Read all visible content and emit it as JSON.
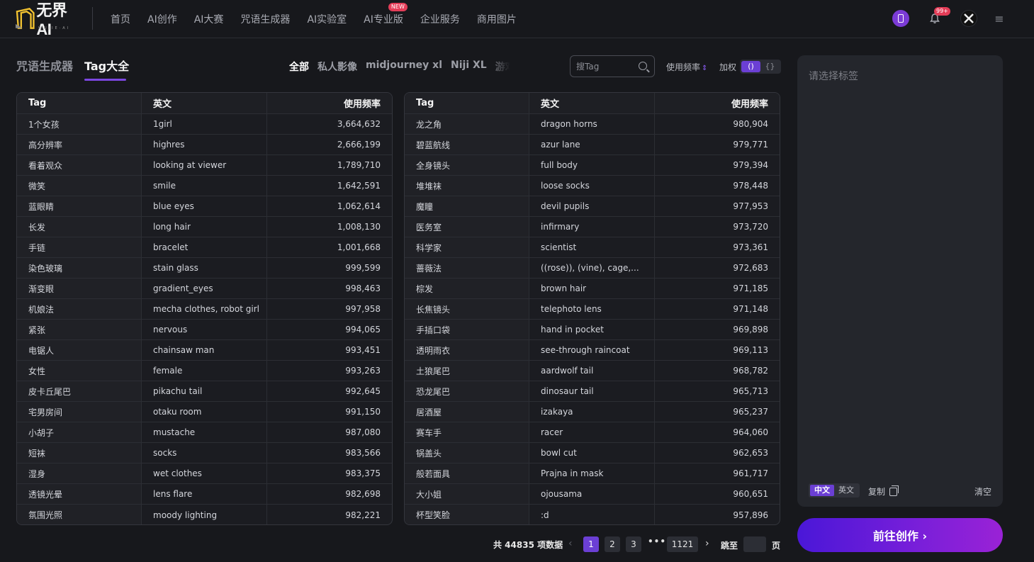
{
  "header": {
    "logo_text": "无界AI",
    "logo_sub": "WUJIE·AI",
    "nav": [
      "首页",
      "AI创作",
      "AI大赛",
      "咒语生成器",
      "AI实验室",
      "AI专业版",
      "企业服务",
      "商用图片"
    ],
    "nav_badge": "NEW",
    "bell_badge": "99+"
  },
  "tabs": {
    "generator": "咒语生成器",
    "tag_all": "Tag大全"
  },
  "categories": [
    "全部",
    "私人影像",
    "midjourney xl",
    "Niji XL",
    "游戏设计"
  ],
  "search": {
    "placeholder": "搜Tag"
  },
  "sort": {
    "label": "使用频率",
    "icon": "sort-icon"
  },
  "weight": {
    "label": "加权",
    "opt1": "()",
    "opt2": "{}"
  },
  "columns": {
    "tag": "Tag",
    "english": "英文",
    "freq": "使用频率"
  },
  "table_left": [
    [
      "1个女孩",
      "1girl",
      "3,664,632"
    ],
    [
      "高分辨率",
      "highres",
      "2,666,199"
    ],
    [
      "看着观众",
      "looking at viewer",
      "1,789,710"
    ],
    [
      "微笑",
      "smile",
      "1,642,591"
    ],
    [
      "蓝眼睛",
      "blue eyes",
      "1,062,614"
    ],
    [
      "长发",
      "long hair",
      "1,008,130"
    ],
    [
      "手链",
      "bracelet",
      "1,001,668"
    ],
    [
      "染色玻璃",
      "stain glass",
      "999,599"
    ],
    [
      "渐变眼",
      "gradient_eyes",
      "998,463"
    ],
    [
      "机娘法",
      "mecha clothes, robot girl",
      "997,958"
    ],
    [
      "紧张",
      "nervous",
      "994,065"
    ],
    [
      "电锯人",
      "chainsaw man",
      "993,451"
    ],
    [
      "女性",
      "female",
      "993,263"
    ],
    [
      "皮卡丘尾巴",
      "pikachu tail",
      "992,645"
    ],
    [
      "宅男房间",
      "otaku room",
      "991,150"
    ],
    [
      "小胡子",
      "mustache",
      "987,080"
    ],
    [
      "短袜",
      "socks",
      "983,566"
    ],
    [
      "湿身",
      "wet clothes",
      "983,375"
    ],
    [
      "透镜光晕",
      "lens flare",
      "982,698"
    ],
    [
      "氛围光照",
      "moody lighting",
      "982,221"
    ]
  ],
  "table_right": [
    [
      "龙之角",
      "dragon horns",
      "980,904"
    ],
    [
      "碧蓝航线",
      "azur lane",
      "979,771"
    ],
    [
      "全身镜头",
      "full body",
      "979,394"
    ],
    [
      "堆堆袜",
      "loose socks",
      "978,448"
    ],
    [
      "魔瞳",
      "devil pupils",
      "977,953"
    ],
    [
      "医务室",
      "infirmary",
      "973,720"
    ],
    [
      "科学家",
      "scientist",
      "973,361"
    ],
    [
      "蔷薇法",
      "((rose)), (vine), cage,...",
      "972,683"
    ],
    [
      "棕发",
      "brown hair",
      "971,185"
    ],
    [
      "长焦镜头",
      "telephoto lens",
      "971,148"
    ],
    [
      "手插口袋",
      "hand in pocket",
      "969,898"
    ],
    [
      "透明雨衣",
      "see-through raincoat",
      "969,113"
    ],
    [
      "土狼尾巴",
      "aardwolf tail",
      "968,782"
    ],
    [
      "恐龙尾巴",
      "dinosaur tail",
      "965,713"
    ],
    [
      "居酒屋",
      "izakaya",
      "965,237"
    ],
    [
      "赛车手",
      "racer",
      "964,060"
    ],
    [
      "锅盖头",
      "bowl cut",
      "962,653"
    ],
    [
      "般若面具",
      "Prajna in mask",
      "961,717"
    ],
    [
      "大小姐",
      "ojousama",
      "960,651"
    ],
    [
      "杯型笑脸",
      ":d",
      "957,896"
    ]
  ],
  "pagination": {
    "total": "共 44835 项数据",
    "pages": [
      "1",
      "2",
      "3"
    ],
    "dots": "•••",
    "last": "1121",
    "jump": "跳至",
    "page": "页"
  },
  "panel": {
    "placeholder": "请选择标签",
    "lang_cn": "中文",
    "lang_en": "英文",
    "copy": "复制",
    "clear": "清空"
  },
  "create_button": "前往创作 ›",
  "colors": {
    "accent": "#6b3fd4",
    "background": "#17181c",
    "badge": "#e43d58"
  }
}
